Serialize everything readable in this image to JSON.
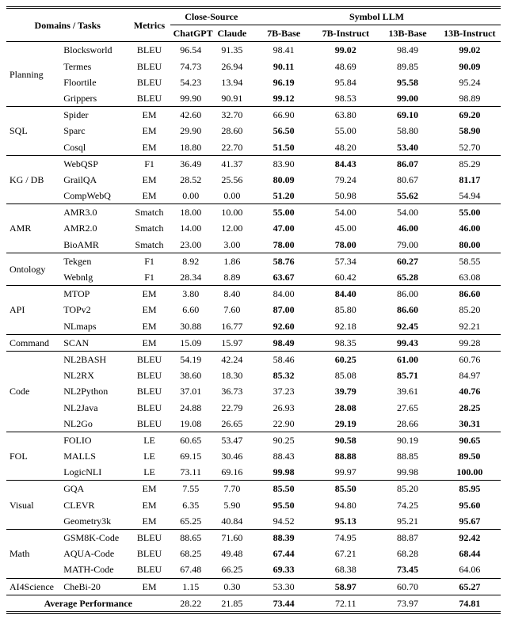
{
  "headers": {
    "domains": "Domains / Tasks",
    "metrics": "Metrics",
    "close_source": "Close-Source",
    "symbol_llm": "Symbol LLM",
    "chatgpt": "ChatGPT",
    "claude": "Claude",
    "b7base": "7B-Base",
    "b7inst": "7B-Instruct",
    "b13base": "13B-Base",
    "b13inst": "13B-Instruct",
    "avg": "Average Performance"
  },
  "groups": [
    {
      "domain": "Planning",
      "rows": [
        {
          "task": "Blocksworld",
          "metric": "BLEU",
          "chatgpt": "96.54",
          "claude": "91.35",
          "b7base": "98.41",
          "b7inst": "99.02",
          "b13base": "98.49",
          "b13inst": "99.02",
          "bold": [
            "b7inst",
            "b13inst"
          ]
        },
        {
          "task": "Termes",
          "metric": "BLEU",
          "chatgpt": "74.73",
          "claude": "26.94",
          "b7base": "90.11",
          "b7inst": "48.69",
          "b13base": "89.85",
          "b13inst": "90.09",
          "bold": [
            "b7base",
            "b13inst"
          ]
        },
        {
          "task": "Floortile",
          "metric": "BLEU",
          "chatgpt": "54.23",
          "claude": "13.94",
          "b7base": "96.19",
          "b7inst": "95.84",
          "b13base": "95.58",
          "b13inst": "95.24",
          "bold": [
            "b7base",
            "b13base"
          ]
        },
        {
          "task": "Grippers",
          "metric": "BLEU",
          "chatgpt": "99.90",
          "claude": "90.91",
          "b7base": "99.12",
          "b7inst": "98.53",
          "b13base": "99.00",
          "b13inst": "98.89",
          "bold": [
            "b7base",
            "b13base"
          ]
        }
      ]
    },
    {
      "domain": "SQL",
      "rows": [
        {
          "task": "Spider",
          "metric": "EM",
          "chatgpt": "42.60",
          "claude": "32.70",
          "b7base": "66.90",
          "b7inst": "63.80",
          "b13base": "69.10",
          "b13inst": "69.20",
          "bold": [
            "b13base",
            "b13inst"
          ]
        },
        {
          "task": "Sparc",
          "metric": "EM",
          "chatgpt": "29.90",
          "claude": "28.60",
          "b7base": "56.50",
          "b7inst": "55.00",
          "b13base": "58.80",
          "b13inst": "58.90",
          "bold": [
            "b7base",
            "b13inst"
          ]
        },
        {
          "task": "Cosql",
          "metric": "EM",
          "chatgpt": "18.80",
          "claude": "22.70",
          "b7base": "51.50",
          "b7inst": "48.20",
          "b13base": "53.40",
          "b13inst": "52.70",
          "bold": [
            "b7base",
            "b13base"
          ]
        }
      ]
    },
    {
      "domain": "KG / DB",
      "rows": [
        {
          "task": "WebQSP",
          "metric": "F1",
          "chatgpt": "36.49",
          "claude": "41.37",
          "b7base": "83.90",
          "b7inst": "84.43",
          "b13base": "86.07",
          "b13inst": "85.29",
          "bold": [
            "b7inst",
            "b13base"
          ]
        },
        {
          "task": "GrailQA",
          "metric": "EM",
          "chatgpt": "28.52",
          "claude": "25.56",
          "b7base": "80.09",
          "b7inst": "79.24",
          "b13base": "80.67",
          "b13inst": "81.17",
          "bold": [
            "b7base",
            "b13inst"
          ]
        },
        {
          "task": "CompWebQ",
          "metric": "EM",
          "chatgpt": "0.00",
          "claude": "0.00",
          "b7base": "51.20",
          "b7inst": "50.98",
          "b13base": "55.62",
          "b13inst": "54.94",
          "bold": [
            "b7base",
            "b13base"
          ]
        }
      ]
    },
    {
      "domain": "AMR",
      "rows": [
        {
          "task": "AMR3.0",
          "metric": "Smatch",
          "chatgpt": "18.00",
          "claude": "10.00",
          "b7base": "55.00",
          "b7inst": "54.00",
          "b13base": "54.00",
          "b13inst": "55.00",
          "bold": [
            "b7base",
            "b13inst"
          ]
        },
        {
          "task": "AMR2.0",
          "metric": "Smatch",
          "chatgpt": "14.00",
          "claude": "12.00",
          "b7base": "47.00",
          "b7inst": "45.00",
          "b13base": "46.00",
          "b13inst": "46.00",
          "bold": [
            "b7base",
            "b13base",
            "b13inst"
          ]
        },
        {
          "task": "BioAMR",
          "metric": "Smatch",
          "chatgpt": "23.00",
          "claude": "3.00",
          "b7base": "78.00",
          "b7inst": "78.00",
          "b13base": "79.00",
          "b13inst": "80.00",
          "bold": [
            "b7base",
            "b7inst",
            "b13inst"
          ]
        }
      ]
    },
    {
      "domain": "Ontology",
      "rows": [
        {
          "task": "Tekgen",
          "metric": "F1",
          "chatgpt": "8.92",
          "claude": "1.86",
          "b7base": "58.76",
          "b7inst": "57.34",
          "b13base": "60.27",
          "b13inst": "58.55",
          "bold": [
            "b7base",
            "b13base"
          ]
        },
        {
          "task": "Webnlg",
          "metric": "F1",
          "chatgpt": "28.34",
          "claude": "8.89",
          "b7base": "63.67",
          "b7inst": "60.42",
          "b13base": "65.28",
          "b13inst": "63.08",
          "bold": [
            "b7base",
            "b13base"
          ]
        }
      ]
    },
    {
      "domain": "API",
      "rows": [
        {
          "task": "MTOP",
          "metric": "EM",
          "chatgpt": "3.80",
          "claude": "8.40",
          "b7base": "84.00",
          "b7inst": "84.40",
          "b13base": "86.00",
          "b13inst": "86.60",
          "bold": [
            "b7inst",
            "b13inst"
          ]
        },
        {
          "task": "TOPv2",
          "metric": "EM",
          "chatgpt": "6.60",
          "claude": "7.60",
          "b7base": "87.00",
          "b7inst": "85.80",
          "b13base": "86.60",
          "b13inst": "85.20",
          "bold": [
            "b7base",
            "b13base"
          ]
        },
        {
          "task": "NLmaps",
          "metric": "EM",
          "chatgpt": "30.88",
          "claude": "16.77",
          "b7base": "92.60",
          "b7inst": "92.18",
          "b13base": "92.45",
          "b13inst": "92.21",
          "bold": [
            "b7base",
            "b13base"
          ]
        }
      ]
    },
    {
      "domain": "Command",
      "rows": [
        {
          "task": "SCAN",
          "metric": "EM",
          "chatgpt": "15.09",
          "claude": "15.97",
          "b7base": "98.49",
          "b7inst": "98.35",
          "b13base": "99.43",
          "b13inst": "99.28",
          "bold": [
            "b7base",
            "b13base"
          ]
        }
      ]
    },
    {
      "domain": "Code",
      "rows": [
        {
          "task": "NL2BASH",
          "metric": "BLEU",
          "chatgpt": "54.19",
          "claude": "42.24",
          "b7base": "58.46",
          "b7inst": "60.25",
          "b13base": "61.00",
          "b13inst": "60.76",
          "bold": [
            "b7inst",
            "b13base"
          ]
        },
        {
          "task": "NL2RX",
          "metric": "BLEU",
          "chatgpt": "38.60",
          "claude": "18.30",
          "b7base": "85.32",
          "b7inst": "85.08",
          "b13base": "85.71",
          "b13inst": "84.97",
          "bold": [
            "b7base",
            "b13base"
          ]
        },
        {
          "task": "NL2Python",
          "metric": "BLEU",
          "chatgpt": "37.01",
          "claude": "36.73",
          "b7base": "37.23",
          "b7inst": "39.79",
          "b13base": "39.61",
          "b13inst": "40.76",
          "bold": [
            "b7inst",
            "b13inst"
          ]
        },
        {
          "task": "NL2Java",
          "metric": "BLEU",
          "chatgpt": "24.88",
          "claude": "22.79",
          "b7base": "26.93",
          "b7inst": "28.08",
          "b13base": "27.65",
          "b13inst": "28.25",
          "bold": [
            "b7inst",
            "b13inst"
          ]
        },
        {
          "task": "NL2Go",
          "metric": "BLEU",
          "chatgpt": "19.08",
          "claude": "26.65",
          "b7base": "22.90",
          "b7inst": "29.19",
          "b13base": "28.66",
          "b13inst": "30.31",
          "bold": [
            "b7inst",
            "b13inst"
          ]
        }
      ]
    },
    {
      "domain": "FOL",
      "rows": [
        {
          "task": "FOLIO",
          "metric": "LE",
          "chatgpt": "60.65",
          "claude": "53.47",
          "b7base": "90.25",
          "b7inst": "90.58",
          "b13base": "90.19",
          "b13inst": "90.65",
          "bold": [
            "b7inst",
            "b13inst"
          ]
        },
        {
          "task": "MALLS",
          "metric": "LE",
          "chatgpt": "69.15",
          "claude": "30.46",
          "b7base": "88.43",
          "b7inst": "88.88",
          "b13base": "88.85",
          "b13inst": "89.50",
          "bold": [
            "b7inst",
            "b13inst"
          ]
        },
        {
          "task": "LogicNLI",
          "metric": "LE",
          "chatgpt": "73.11",
          "claude": "69.16",
          "b7base": "99.98",
          "b7inst": "99.97",
          "b13base": "99.98",
          "b13inst": "100.00",
          "bold": [
            "b7base",
            "b13inst"
          ]
        }
      ]
    },
    {
      "domain": "Visual",
      "rows": [
        {
          "task": "GQA",
          "metric": "EM",
          "chatgpt": "7.55",
          "claude": "7.70",
          "b7base": "85.50",
          "b7inst": "85.50",
          "b13base": "85.20",
          "b13inst": "85.95",
          "bold": [
            "b7base",
            "b7inst",
            "b13inst"
          ]
        },
        {
          "task": "CLEVR",
          "metric": "EM",
          "chatgpt": "6.35",
          "claude": "5.90",
          "b7base": "95.50",
          "b7inst": "94.80",
          "b13base": "74.25",
          "b13inst": "95.60",
          "bold": [
            "b7base",
            "b13inst"
          ]
        },
        {
          "task": "Geometry3k",
          "metric": "EM",
          "chatgpt": "65.25",
          "claude": "40.84",
          "b7base": "94.52",
          "b7inst": "95.13",
          "b13base": "95.21",
          "b13inst": "95.67",
          "bold": [
            "b7inst",
            "b13inst"
          ]
        }
      ]
    },
    {
      "domain": "Math",
      "rows": [
        {
          "task": "GSM8K-Code",
          "metric": "BLEU",
          "chatgpt": "88.65",
          "claude": "71.60",
          "b7base": "88.39",
          "b7inst": "74.95",
          "b13base": "88.87",
          "b13inst": "92.42",
          "bold": [
            "b7base",
            "b13inst"
          ]
        },
        {
          "task": "AQUA-Code",
          "metric": "BLEU",
          "chatgpt": "68.25",
          "claude": "49.48",
          "b7base": "67.44",
          "b7inst": "67.21",
          "b13base": "68.28",
          "b13inst": "68.44",
          "bold": [
            "b7base",
            "b13inst"
          ]
        },
        {
          "task": "MATH-Code",
          "metric": "BLEU",
          "chatgpt": "67.48",
          "claude": "66.25",
          "b7base": "69.33",
          "b7inst": "68.38",
          "b13base": "73.45",
          "b13inst": "64.06",
          "bold": [
            "b7base",
            "b13base"
          ]
        }
      ]
    },
    {
      "domain": "AI4Science",
      "rows": [
        {
          "task": "CheBi-20",
          "metric": "EM",
          "chatgpt": "1.15",
          "claude": "0.30",
          "b7base": "53.30",
          "b7inst": "58.97",
          "b13base": "60.70",
          "b13inst": "65.27",
          "bold": [
            "b7inst",
            "b13inst"
          ]
        }
      ]
    }
  ],
  "average": {
    "chatgpt": "28.22",
    "claude": "21.85",
    "b7base": "73.44",
    "b7inst": "72.11",
    "b13base": "73.97",
    "b13inst": "74.81",
    "bold": [
      "b7base",
      "b13inst"
    ]
  },
  "chart_data": {
    "type": "table",
    "title": "Benchmark results across domains",
    "columns": [
      "Domain",
      "Task",
      "Metric",
      "ChatGPT",
      "Claude",
      "7B-Base",
      "7B-Instruct",
      "13B-Base",
      "13B-Instruct"
    ]
  }
}
